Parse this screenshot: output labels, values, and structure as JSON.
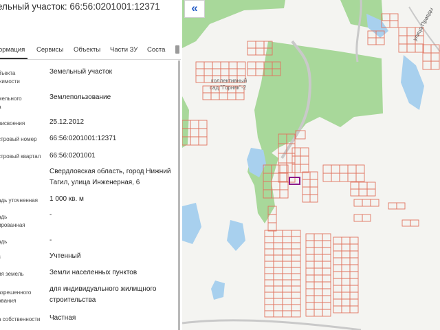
{
  "header": {
    "title": "ельный участок: 66:56:0201001:12371"
  },
  "tabs": [
    {
      "label": "ормация",
      "active": true
    },
    {
      "label": "Сервисы",
      "active": false
    },
    {
      "label": "Объекты",
      "active": false
    },
    {
      "label": "Части ЗУ",
      "active": false
    },
    {
      "label": "Соста",
      "active": false
    }
  ],
  "properties": [
    {
      "label": [
        "бъекта",
        "жимости"
      ],
      "value": "Земельный участок"
    },
    {
      "label": [
        "мельного",
        "а"
      ],
      "value": "Землепользование"
    },
    {
      "label": [
        "рисвоения"
      ],
      "value": "25.12.2012"
    },
    {
      "label": [
        "стровый номер"
      ],
      "value": "66:56:0201001:12371"
    },
    {
      "label": [
        "стровый квартал"
      ],
      "value": "66:56:0201001"
    },
    {
      "label": [
        ""
      ],
      "value": "Свердловская область, город Нижний Тагил, улица Инженерная, 6"
    },
    {
      "label": [
        "адь уточненная"
      ],
      "value": "1 000 кв. м"
    },
    {
      "label": [
        "адь",
        "ированная"
      ],
      "value": "-"
    },
    {
      "label": [
        "адь"
      ],
      "value": "-"
    },
    {
      "label": [
        "с"
      ],
      "value": "Учтенный"
    },
    {
      "label": [
        "ия земель"
      ],
      "value": "Земли населенных пунктов"
    },
    {
      "label": [
        "азрешенного",
        "ования"
      ],
      "value": "для индивидуального жилищного строительства"
    },
    {
      "label": [
        "а собственности"
      ],
      "value": "Частная"
    }
  ],
  "map": {
    "collapse_label": "«",
    "garden_label_1": "коллективный",
    "garden_label_2": "сад \"Горняк\"-2",
    "street_label": "улица Правды",
    "colors": {
      "forest": "#a8d89a",
      "water": "#a8d0ee",
      "parcel": "#e0735f",
      "selected": "#8b1a8b",
      "background": "#f4f4f1"
    }
  }
}
